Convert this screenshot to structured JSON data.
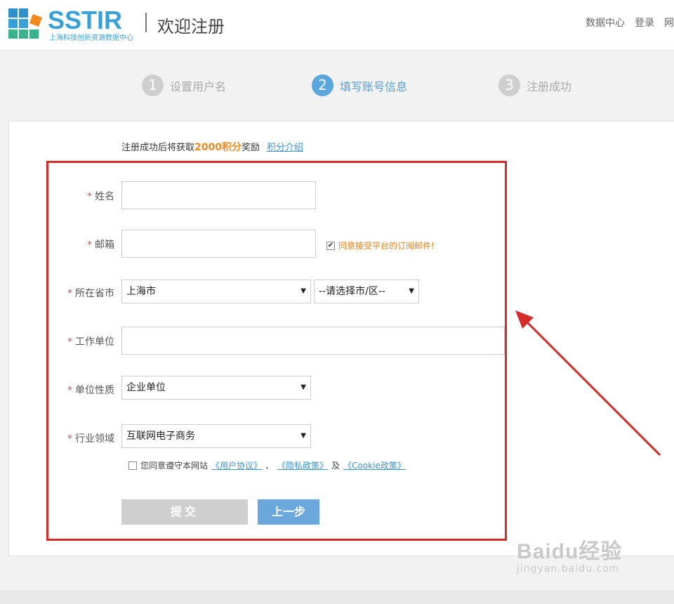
{
  "header": {
    "logo_text": "SSTIR",
    "logo_subtitle": "上海科技创新资源数据中心",
    "title": "欢迎注册",
    "nav": [
      "数据中心",
      "登录",
      "网"
    ]
  },
  "steps": [
    {
      "num": "1",
      "label": "设置用户名",
      "active": false
    },
    {
      "num": "2",
      "label": "填写账号信息",
      "active": true
    },
    {
      "num": "3",
      "label": "注册成功",
      "active": false
    }
  ],
  "bonus": {
    "prefix": "注册成功后将获取",
    "points": "2000积分",
    "suffix": "奖励",
    "link": "积分介绍"
  },
  "form": {
    "name_label": "姓名",
    "email_label": "邮箱",
    "subscribe_text": "同意接受平台的订阅邮件!",
    "subscribe_checked": true,
    "province_label": "所在省市",
    "province_value": "上海市",
    "city_value": "--请选择市/区--",
    "company_label": "工作单位",
    "org_type_label": "单位性质",
    "org_type_value": "企业单位",
    "industry_label": "行业领域",
    "industry_value": "互联网电子商务",
    "agree_prefix": "您同意遵守本网站",
    "agree_link1": "《用户协议》",
    "agree_sep": "、",
    "agree_link2": "《隐私政策》",
    "agree_and": "及",
    "agree_link3": "《Cookie政策》",
    "agree_checked": false,
    "submit_label": "提交",
    "prev_label": "上一步",
    "required_mark": "*"
  },
  "watermark": {
    "main": "Baidu经验",
    "sub": "jingyan.baidu.com"
  },
  "colors": {
    "accent_blue": "#5ba6dc",
    "highlight_red": "#d52b2b",
    "points_orange": "#f08a1c"
  }
}
